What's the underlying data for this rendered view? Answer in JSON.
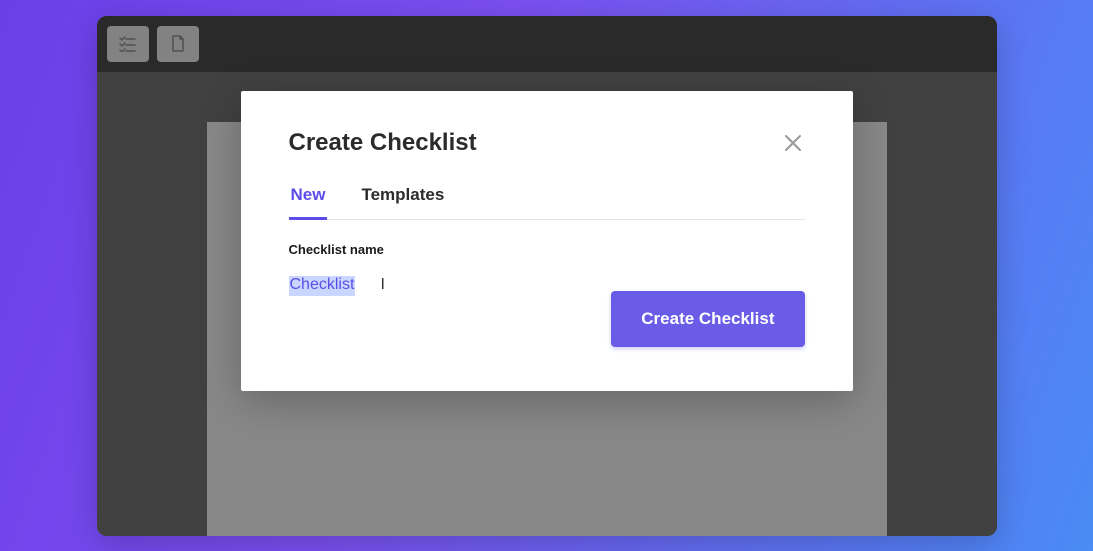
{
  "modal": {
    "title": "Create Checklist",
    "tabs": [
      {
        "label": "New",
        "active": true
      },
      {
        "label": "Templates",
        "active": false
      }
    ],
    "field_label": "Checklist name",
    "name_value": "Checklist",
    "submit_label": "Create Checklist"
  },
  "colors": {
    "accent": "#6b5ce8",
    "text_primary": "#2b2b2b"
  }
}
